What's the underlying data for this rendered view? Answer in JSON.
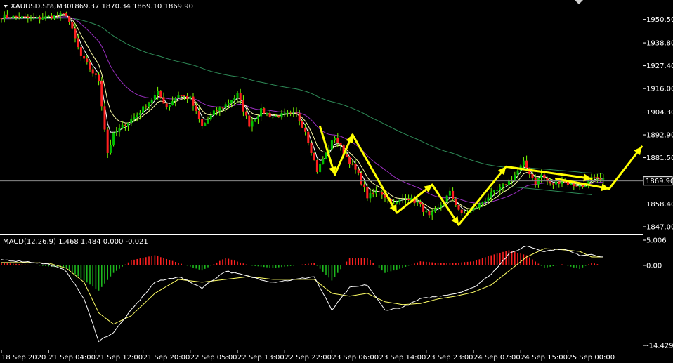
{
  "chart_data": {
    "type": "candlestick",
    "header": {
      "symbol": "XAUUSD.Sta,M30",
      "ohlc": "1869.37 1870.34 1869.10 1869.90"
    },
    "price_axis": {
      "ticks": [
        "1950.50",
        "1938.80",
        "1927.40",
        "1916.00",
        "1904.30",
        "1892.90",
        "1881.50",
        "1858.40",
        "1847.00"
      ],
      "tick_values": [
        1950.5,
        1938.8,
        1927.4,
        1916.0,
        1904.3,
        1892.9,
        1881.5,
        1858.4,
        1847.0
      ],
      "ylim": [
        1843.5,
        1956.0
      ],
      "current_price": 1869.9,
      "current_price_label": "1869.90"
    },
    "x_axis": {
      "labels": [
        "18 Sep 2020",
        "21 Sep 04:00",
        "21 Sep 12:00",
        "21 Sep 20:00",
        "22 Sep 05:00",
        "22 Sep 13:00",
        "22 Sep 22:00",
        "23 Sep 06:00",
        "23 Sep 14:00",
        "23 Sep 23:00",
        "24 Sep 07:00",
        "24 Sep 15:00",
        "25 Sep 00:00"
      ],
      "label_index": [
        0,
        16,
        32,
        48,
        64,
        80,
        96,
        112,
        128,
        144,
        160,
        176,
        192
      ],
      "bar_count": 205
    },
    "price_path": {
      "index": [
        0,
        12,
        22,
        24,
        27,
        33,
        36,
        38,
        41,
        46,
        53,
        56,
        60,
        64,
        68,
        72,
        76,
        80,
        84,
        88,
        92,
        96,
        100,
        103,
        107,
        113,
        116,
        121,
        124,
        128,
        133,
        137,
        141,
        145,
        148,
        152,
        156,
        159,
        162,
        165,
        169,
        173,
        177,
        181,
        183,
        186,
        190,
        193,
        197,
        200,
        204
      ],
      "close": [
        1952,
        1951,
        1953,
        1945,
        1932,
        1920,
        1884,
        1893,
        1897,
        1903,
        1914,
        1907,
        1913,
        1911,
        1897,
        1904,
        1908,
        1913,
        1898,
        1905,
        1902,
        1903,
        1903,
        1895,
        1875,
        1892,
        1884,
        1873,
        1862,
        1865,
        1858,
        1862,
        1859,
        1852,
        1856,
        1864,
        1853,
        1855,
        1858,
        1862,
        1866,
        1871,
        1879,
        1869,
        1873,
        1868,
        1870,
        1868,
        1867,
        1871,
        1870
      ]
    },
    "moving_averages": [
      {
        "color": "#2e8b57",
        "period": 100
      },
      {
        "color": "#9b2fc2",
        "period": 26
      },
      {
        "color": "#ffffaa",
        "period": 8
      },
      {
        "color": "#ffffff",
        "period": 4
      }
    ],
    "annotations": {
      "color": "#ffff00",
      "zigzag": [
        {
          "i": 108,
          "p": 1897
        },
        {
          "i": 113,
          "p": 1873
        },
        {
          "i": 119,
          "p": 1893
        },
        {
          "i": 134,
          "p": 1854
        },
        {
          "i": 146,
          "p": 1868
        },
        {
          "i": 155,
          "p": 1848
        },
        {
          "i": 171,
          "p": 1877
        }
      ],
      "channel_upper": [
        {
          "i": 171,
          "p": 1877
        },
        {
          "i": 200,
          "p": 1871
        }
      ],
      "channel_lower": [
        {
          "i": 173,
          "p": 1867
        },
        {
          "i": 200,
          "p": 1863
        }
      ],
      "forecast": [
        {
          "i": 188,
          "p": 1871
        },
        {
          "i": 206,
          "p": 1866
        },
        {
          "i": 217,
          "p": 1887
        }
      ]
    },
    "macd": {
      "label": "MACD(12,26,9) 1.468 1.484 0.000 -0.021",
      "ticks": [
        "5.006",
        "0.00",
        "-14.429"
      ],
      "tick_values": [
        5.006,
        0.0,
        -14.429
      ],
      "ylim": [
        -14.429,
        5.006
      ],
      "index": [
        0,
        10,
        16,
        22,
        28,
        33,
        38,
        44,
        52,
        60,
        68,
        76,
        84,
        92,
        100,
        106,
        112,
        118,
        124,
        130,
        136,
        142,
        148,
        154,
        160,
        166,
        172,
        178,
        184,
        190,
        196,
        200,
        204
      ],
      "line": [
        1.0,
        0.6,
        0.2,
        -1.0,
        -6.0,
        -13.5,
        -12.0,
        -8.0,
        -3.0,
        -2.0,
        -4.0,
        -1.0,
        -2.0,
        -3.0,
        -2.5,
        -2.0,
        -8.0,
        -4.0,
        -3.5,
        -8.0,
        -7.5,
        -6.0,
        -5.5,
        -5.0,
        -4.0,
        -1.5,
        2.0,
        3.5,
        2.5,
        3.0,
        1.8,
        2.0,
        1.5
      ],
      "signal": [
        0.5,
        0.5,
        0.4,
        -0.5,
        -3.0,
        -8.5,
        -10.5,
        -9.0,
        -5.0,
        -2.5,
        -3.0,
        -2.5,
        -2.0,
        -2.5,
        -2.5,
        -2.5,
        -5.0,
        -5.5,
        -5.0,
        -6.5,
        -7.0,
        -6.8,
        -6.0,
        -5.5,
        -4.8,
        -3.5,
        -1.0,
        1.5,
        3.0,
        2.8,
        2.5,
        1.5,
        1.5
      ],
      "line_color": "#ffffff",
      "signal_color": "#ffff66",
      "hist_up_color": "#ff2020",
      "hist_down_color": "#1db81d"
    },
    "colors": {
      "bull_body": "#00c000",
      "bear_body": "#ff2020",
      "wick": "#7cfc00",
      "price_line": "#8a8a8a",
      "background": "#000000",
      "axis": "#ffffff"
    }
  }
}
